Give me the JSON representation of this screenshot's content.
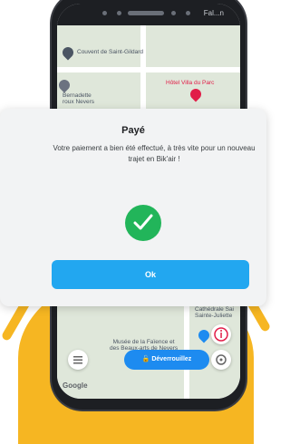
{
  "map": {
    "places": [
      {
        "label": "Couvent de Saint-Gildard"
      },
      {
        "label": "Bernadette\nroux Nevers"
      },
      {
        "label": "Hôtel Villa du Parc"
      },
      {
        "label": "Cathédrale Sai\nSainte-Juliette"
      },
      {
        "label": "Musée de la Faïence et\ndes Beaux-arts de Nevers"
      }
    ],
    "google": "Google"
  },
  "modal": {
    "title": "Payé",
    "message": "Votre paiement a bien été effectué, à très vite pour un nouveau trajet en Bik'air !",
    "ok": "Ok"
  },
  "bottom": {
    "unlock": "Déverrouillez"
  }
}
